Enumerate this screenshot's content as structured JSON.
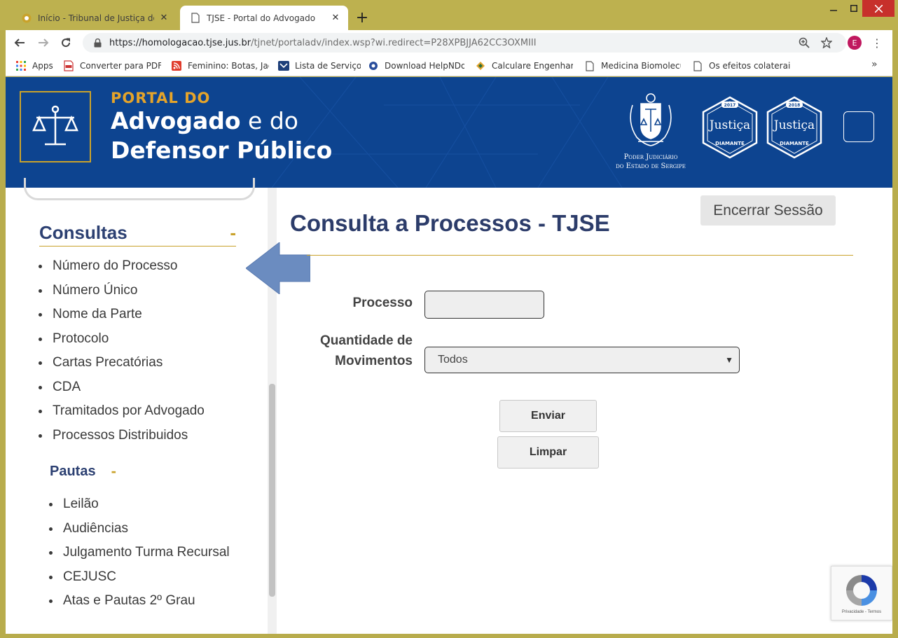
{
  "browser": {
    "tabs": [
      {
        "title": "Início - Tribunal de Justiça do Estado de Sergipe",
        "active": false
      },
      {
        "title": "TJSE - Portal do Advogado",
        "active": true
      }
    ],
    "new_tab": "+",
    "url_host": "https://homologacao.tjse.jus.br",
    "url_path": "/tjnet/portaladv/index.wsp?wi.redirect=P28XPBJJA62CC3OXMIII",
    "profile_initial": "E",
    "bookmarks": [
      {
        "label": "Apps",
        "icon": "apps-grid-icon"
      },
      {
        "label": "Converter para PDF –",
        "icon": "pdf-icon"
      },
      {
        "label": "Feminino: Botas, Jaqu",
        "icon": "rss-icon"
      },
      {
        "label": "Lista de Serviços",
        "icon": "services-icon"
      },
      {
        "label": "Download HelpNDoc",
        "icon": "helpndoc-icon"
      },
      {
        "label": "Calculare Engenharia",
        "icon": "calculare-icon"
      },
      {
        "label": "Medicina Biomolecul",
        "icon": "page-icon"
      },
      {
        "label": "Os efeitos colaterais",
        "icon": "page-icon"
      }
    ],
    "bookmarks_more": "»"
  },
  "banner": {
    "line1": "PORTAL DO",
    "line2_bold": "Advogado",
    "line2_thin": " e do",
    "line3": "Defensor Público",
    "tj_line1": "Poder Judiciário",
    "tj_line2": "do Estado de Sergipe",
    "seal_text": "Justiça",
    "seal_sub": "DIAMANTE",
    "seal1_year": "2017",
    "seal2_year": "2018"
  },
  "sidebar": {
    "consultas_title": "Consultas",
    "consultas_toggle": "-",
    "consultas_items": [
      "Número do Processo",
      "Número Único",
      "Nome da Parte",
      "Protocolo",
      "Cartas Precatórias",
      "CDA",
      "Tramitados por Advogado",
      "Processos Distribuidos"
    ],
    "pautas_title": "Pautas",
    "pautas_toggle": "-",
    "pautas_items": [
      "Leilão",
      "Audiências",
      "Julgamento Turma Recursal",
      "CEJUSC",
      "Atas e Pautas 2º Grau"
    ]
  },
  "main": {
    "title": "Consulta a Processos - TJSE",
    "logout_label": "Encerrar Sessão",
    "processo_label": "Processo",
    "processo_value": "",
    "qtd_label_line1": "Quantidade de",
    "qtd_label_line2": "Movimentos",
    "qtd_selected": "Todos",
    "submit_label": "Enviar",
    "clear_label": "Limpar"
  },
  "recaptcha": {
    "text": "Privacidade - Termos"
  },
  "colors": {
    "banner_blue": "#0d4490",
    "accent_gold": "#c9a22b",
    "heading_navy": "#2c3c6a",
    "chrome_frame": "#bdb14f"
  }
}
